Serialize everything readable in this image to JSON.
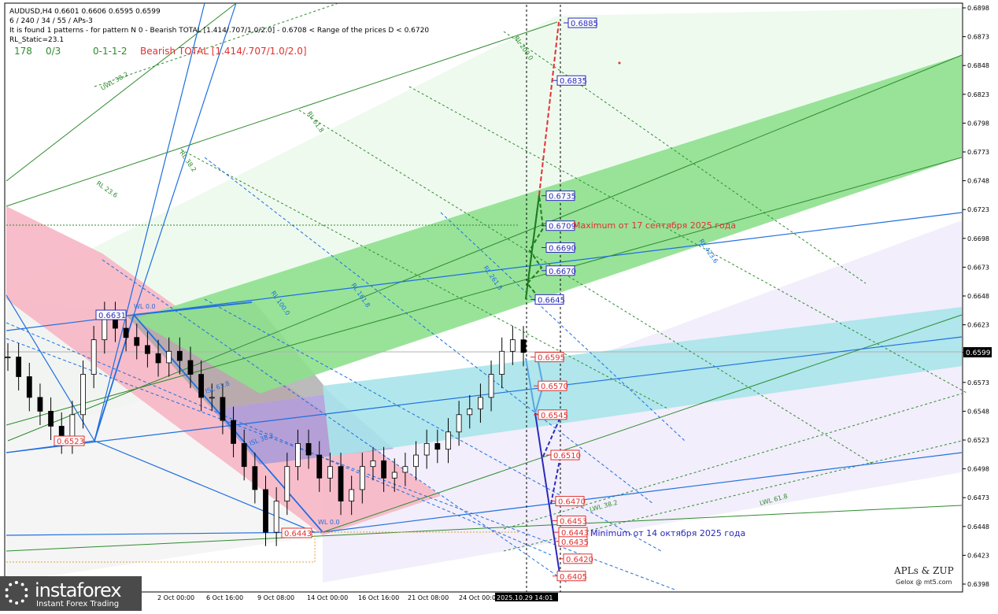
{
  "header": {
    "symbol_line": "AUDUSD,H4  0.6601 0.6606 0.6595 0.6599",
    "params_line": "6 / 240 / 34 / 55 / APs-3",
    "pattern_line": "It is found 1 patterns  -  for pattern N 0 - Bearish TOTAL [1.414/.707/1.0/2.0] - 0.6708 < Range of the prices D < 0.6720",
    "rl_static": "RL_Static=23.1",
    "count_178": "178",
    "count_03": "0/3",
    "count_seq": "0-1-1-2",
    "pattern_name": "Bearish TOTAL [1.414/.707/1.0/2.0]"
  },
  "colors": {
    "pink_channel": "#f7b6c4",
    "green_channel": "#8ee08e",
    "cyan_channel": "#a8e4ea",
    "blue_line": "#1e6fe0",
    "green_line": "#2e8b2e",
    "red_target": "#e03030",
    "navy_path": "#2a2ab8"
  },
  "annotations": {
    "maximum": "Maximum от 17 сентября 2025 года",
    "minimum": "Minimum от 14 октября 2025 года",
    "brand": "APLs & ZUP",
    "brand_sub": "Gelox @ mt5.com",
    "logo_name": "instaforex",
    "logo_tag": "Instant Forex Trading"
  },
  "level_labels": {
    "l0631": "0.6631",
    "l0523": "0.6523",
    "l0443": "0.6443",
    "fan": [
      "RL 23.6",
      "RL 38.2",
      "RL 61.8",
      "RL 100.0",
      "RL 161.8",
      "RL 261.8",
      "RL 423.6",
      "UWL 38.2",
      "LWL 38.2",
      "LWL 61.8",
      "ISL 61.8",
      "ISL 38.2",
      "WL 0.0",
      "RL 200.0"
    ]
  },
  "chart_data": {
    "type": "line",
    "title": "AUDUSD,H4",
    "x_ticks": [
      "2 Oct 00:00",
      "6 Oct 16:00",
      "9 Oct 08:00",
      "14 Oct 00:00",
      "16 Oct 16:00",
      "21 Oct 08:00",
      "24 Oct 00:00",
      "2025.10.29 14:01"
    ],
    "ylim": [
      0.6398,
      0.6898
    ],
    "y_ticks": [
      "0.6898",
      "0.6873",
      "0.6848",
      "0.6823",
      "0.6798",
      "0.6773",
      "0.6748",
      "0.6723",
      "0.6698",
      "0.6673",
      "0.6648",
      "0.6623",
      "0.6599",
      "0.6573",
      "0.6548",
      "0.6523",
      "0.6498",
      "0.6473",
      "0.6448",
      "0.6423",
      "0.6398"
    ],
    "current_price": 0.6599,
    "current_price_label": "0.6599",
    "price_points": [
      0.6595,
      0.6578,
      0.656,
      0.6548,
      0.6535,
      0.6523,
      0.6545,
      0.658,
      0.661,
      0.6631,
      0.662,
      0.6612,
      0.6605,
      0.6598,
      0.659,
      0.66,
      0.6592,
      0.658,
      0.656,
      0.656,
      0.654,
      0.652,
      0.65,
      0.648,
      0.6443,
      0.647,
      0.65,
      0.652,
      0.651,
      0.649,
      0.65,
      0.647,
      0.648,
      0.65,
      0.6505,
      0.649,
      0.6495,
      0.65,
      0.651,
      0.652,
      0.6515,
      0.653,
      0.6545,
      0.655,
      0.656,
      0.658,
      0.66,
      0.661,
      0.6599
    ],
    "target_levels_up": [
      "0.6885",
      "0.6835",
      "0.6735",
      "0.6709",
      "0.6690",
      "0.6670",
      "0.6645"
    ],
    "target_levels_down": [
      "0.6595",
      "0.6570",
      "0.6545",
      "0.6510",
      "0.6470",
      "0.6453",
      "0.6443",
      "0.6435",
      "0.6420",
      "0.6405"
    ]
  }
}
